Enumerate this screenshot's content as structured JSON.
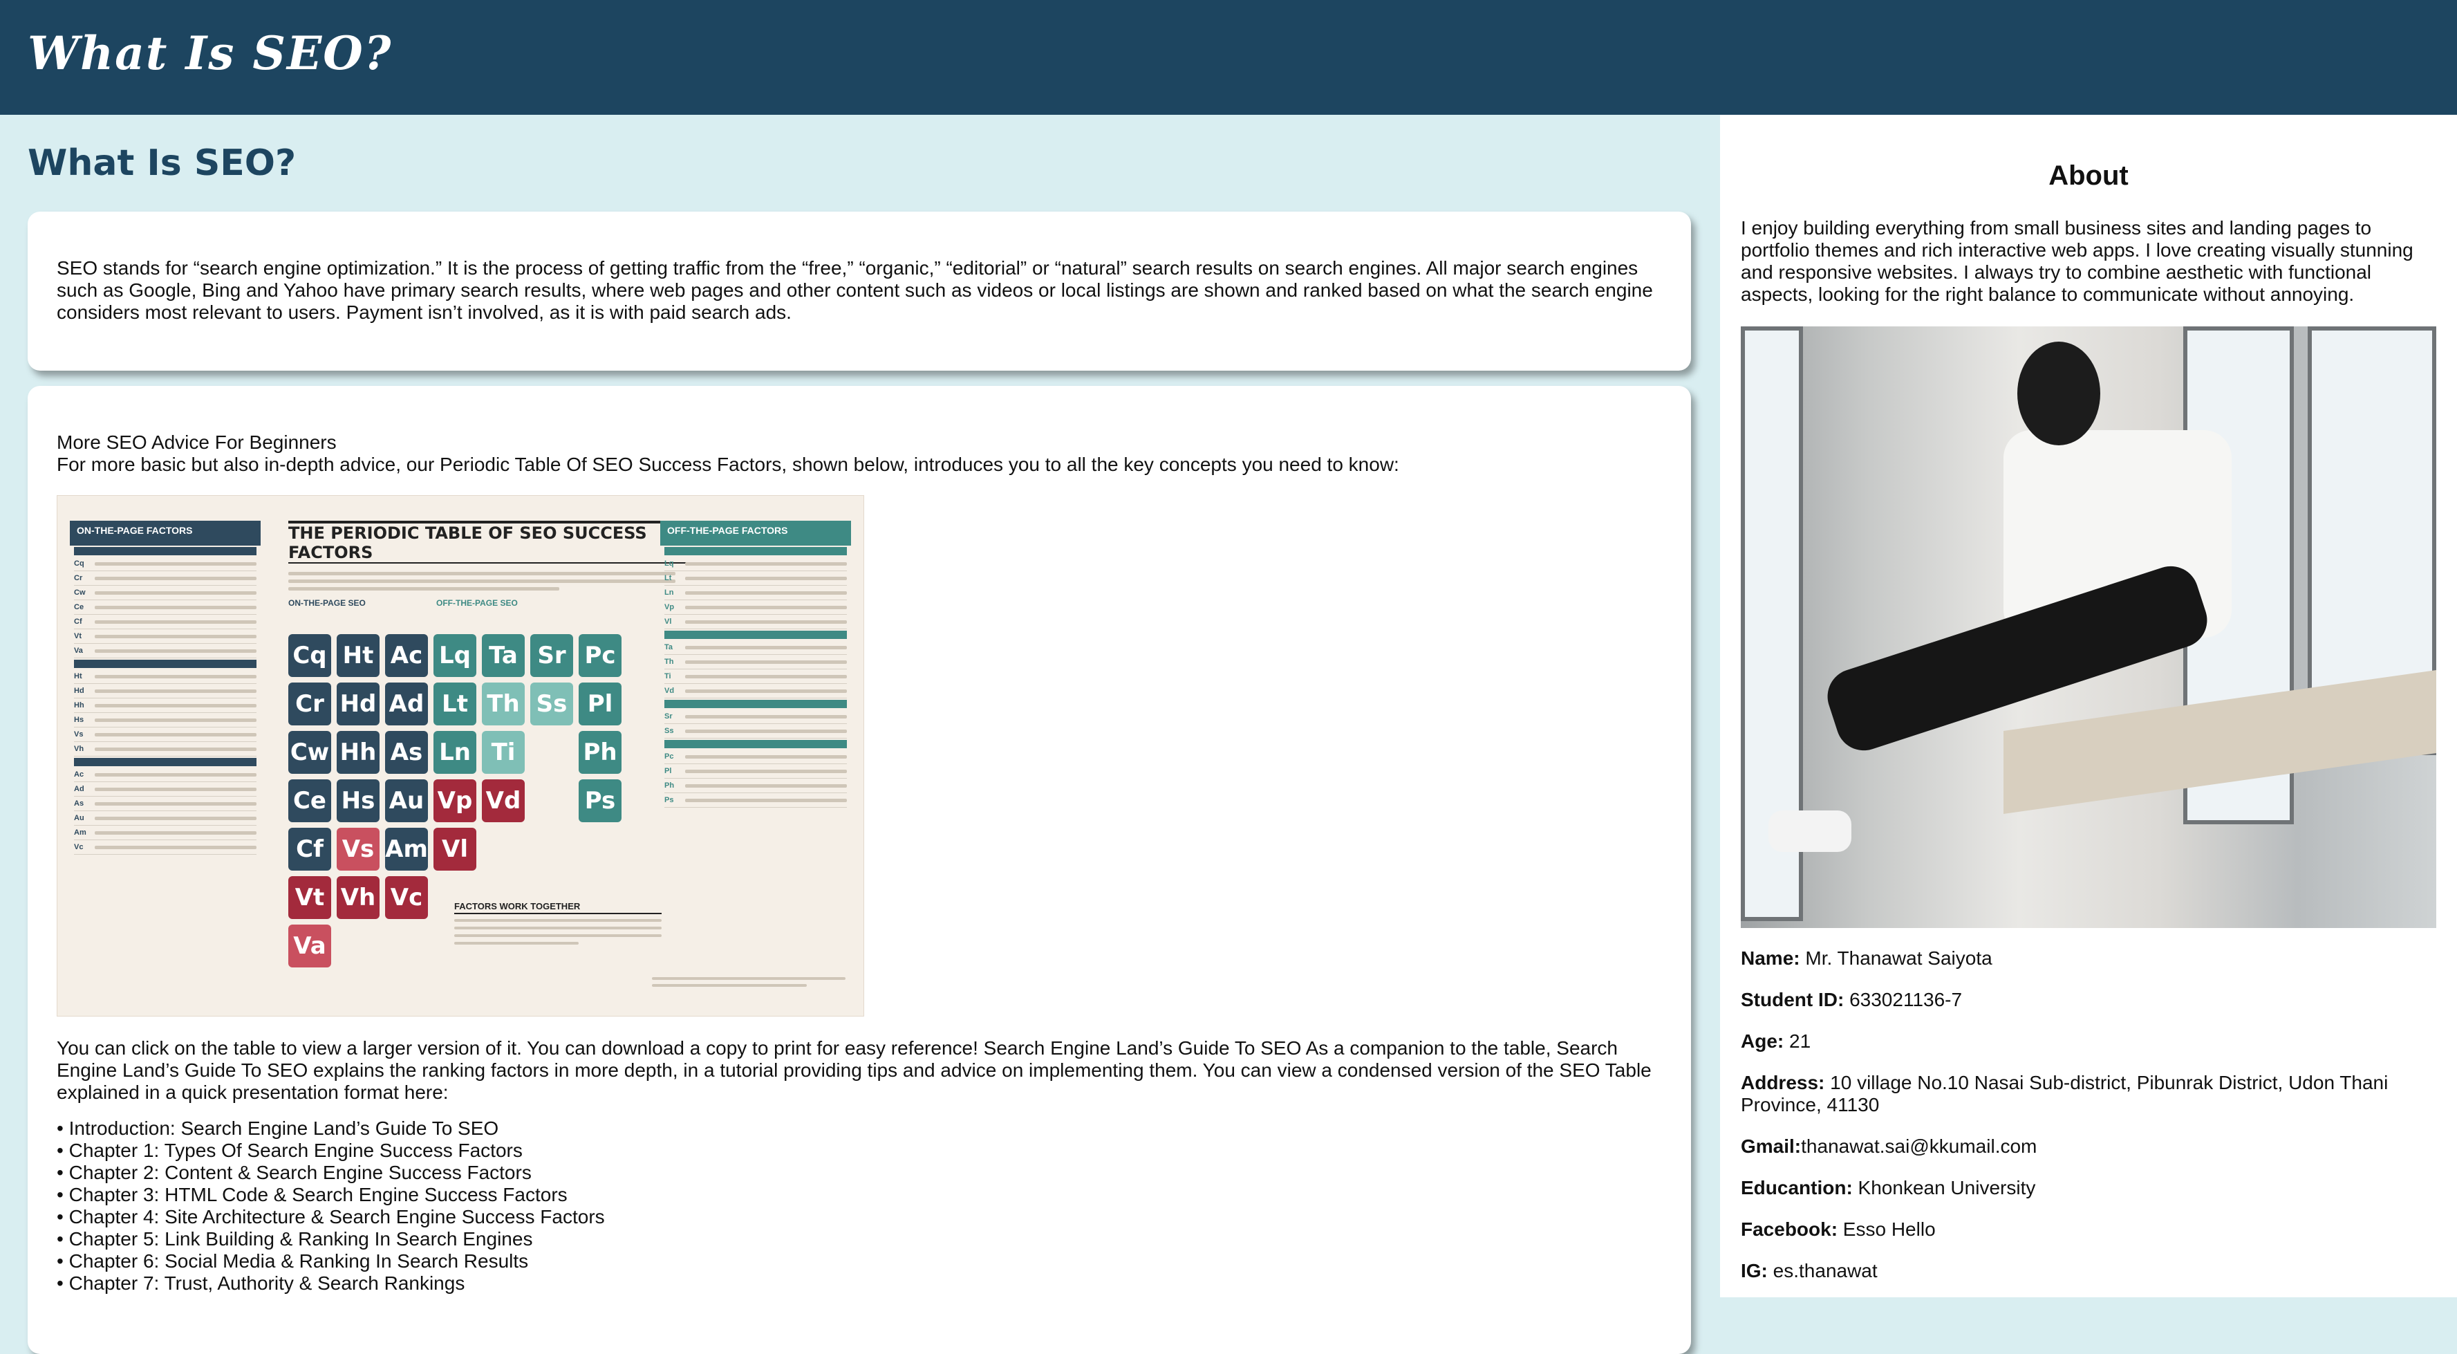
{
  "header": {
    "brand": "What Is SEO?"
  },
  "main": {
    "title": "What Is SEO?",
    "intro": "SEO stands for “search engine optimization.” It is the process of getting traffic from the “free,” “organic,” “editorial” or “natural” search results on search engines. All major search engines such as Google, Bing and Yahoo have primary search results, where web pages and other content such as videos or local listings are shown and ranked based on what the search engine considers most relevant to users. Payment isn’t involved, as it is with paid search ads.",
    "advice_heading": "More SEO Advice For Beginners",
    "advice_text": "For more basic but also in-depth advice, our Periodic Table Of SEO Success Factors, shown below, introduces you to all the key concepts you need to know:",
    "table_image": {
      "title": "THE PERIODIC TABLE OF SEO SUCCESS FACTORS",
      "left_header": "ON-THE-PAGE FACTORS",
      "right_header": "OFF-THE-PAGE FACTORS",
      "onpage_label": "ON-THE-PAGE SEO",
      "offpage_label": "OFF-THE-PAGE SEO",
      "note_title": "FACTORS WORK TOGETHER",
      "tiles": [
        "Cq",
        "Ht",
        "Ac",
        "Lq",
        "Ta",
        "Sr",
        "Pc",
        "Cr",
        "Hd",
        "Ad",
        "Lt",
        "Th",
        "Ss",
        "Pl",
        "Cw",
        "Hh",
        "As",
        "Ln",
        "Ti",
        "Ph",
        "Ce",
        "Hs",
        "Au",
        "Vp",
        "Vd",
        "Ps",
        "Cf",
        "Vs",
        "Am",
        "Vl",
        "Vt",
        "Vh",
        "Vc",
        "Va"
      ]
    },
    "after_table": "You can click on the table to view a larger version of it. You can download a copy to print for easy reference! Search Engine Land’s Guide To SEO As a companion to the table, Search Engine Land’s Guide To SEO explains the ranking factors in more depth, in a tutorial providing tips and advice on implementing them. You can view a condensed version of the SEO Table explained in a quick presentation format here:",
    "chapters": [
      "Introduction: Search Engine Land’s Guide To SEO",
      "Chapter 1: Types Of Search Engine Success Factors",
      "Chapter 2: Content & Search Engine Success Factors",
      "Chapter 3: HTML Code & Search Engine Success Factors",
      "Chapter 4: Site Architecture & Search Engine Success Factors",
      "Chapter 5: Link Building & Ranking In Search Engines",
      "Chapter 6: Social Media & Ranking In Search Results",
      "Chapter 7: Trust, Authority & Search Rankings"
    ]
  },
  "sidebar": {
    "title": "About",
    "about": "I enjoy building everything from small business sites and landing pages to portfolio themes and rich interactive web apps. I love creating visually stunning and responsive websites. I always try to combine aesthetic with functional aspects, looking for the right balance to communicate without annoying.",
    "info": [
      {
        "label": "Name:",
        "value": " Mr. Thanawat Saiyota"
      },
      {
        "label": "Student ID:",
        "value": " 633021136-7"
      },
      {
        "label": "Age:",
        "value": " 21"
      },
      {
        "label": "Address:",
        "value": " 10 village No.10 Nasai Sub-district, Pibunrak District, Udon Thani Province, 41130"
      },
      {
        "label": "Gmail:",
        "value": "thanawat.sai@kkumail.com"
      },
      {
        "label": "Educantion:",
        "value": " Khonkean University"
      },
      {
        "label": "Facebook:",
        "value": " Esso Hello"
      },
      {
        "label": "IG:",
        "value": " es.thanawat"
      }
    ]
  }
}
